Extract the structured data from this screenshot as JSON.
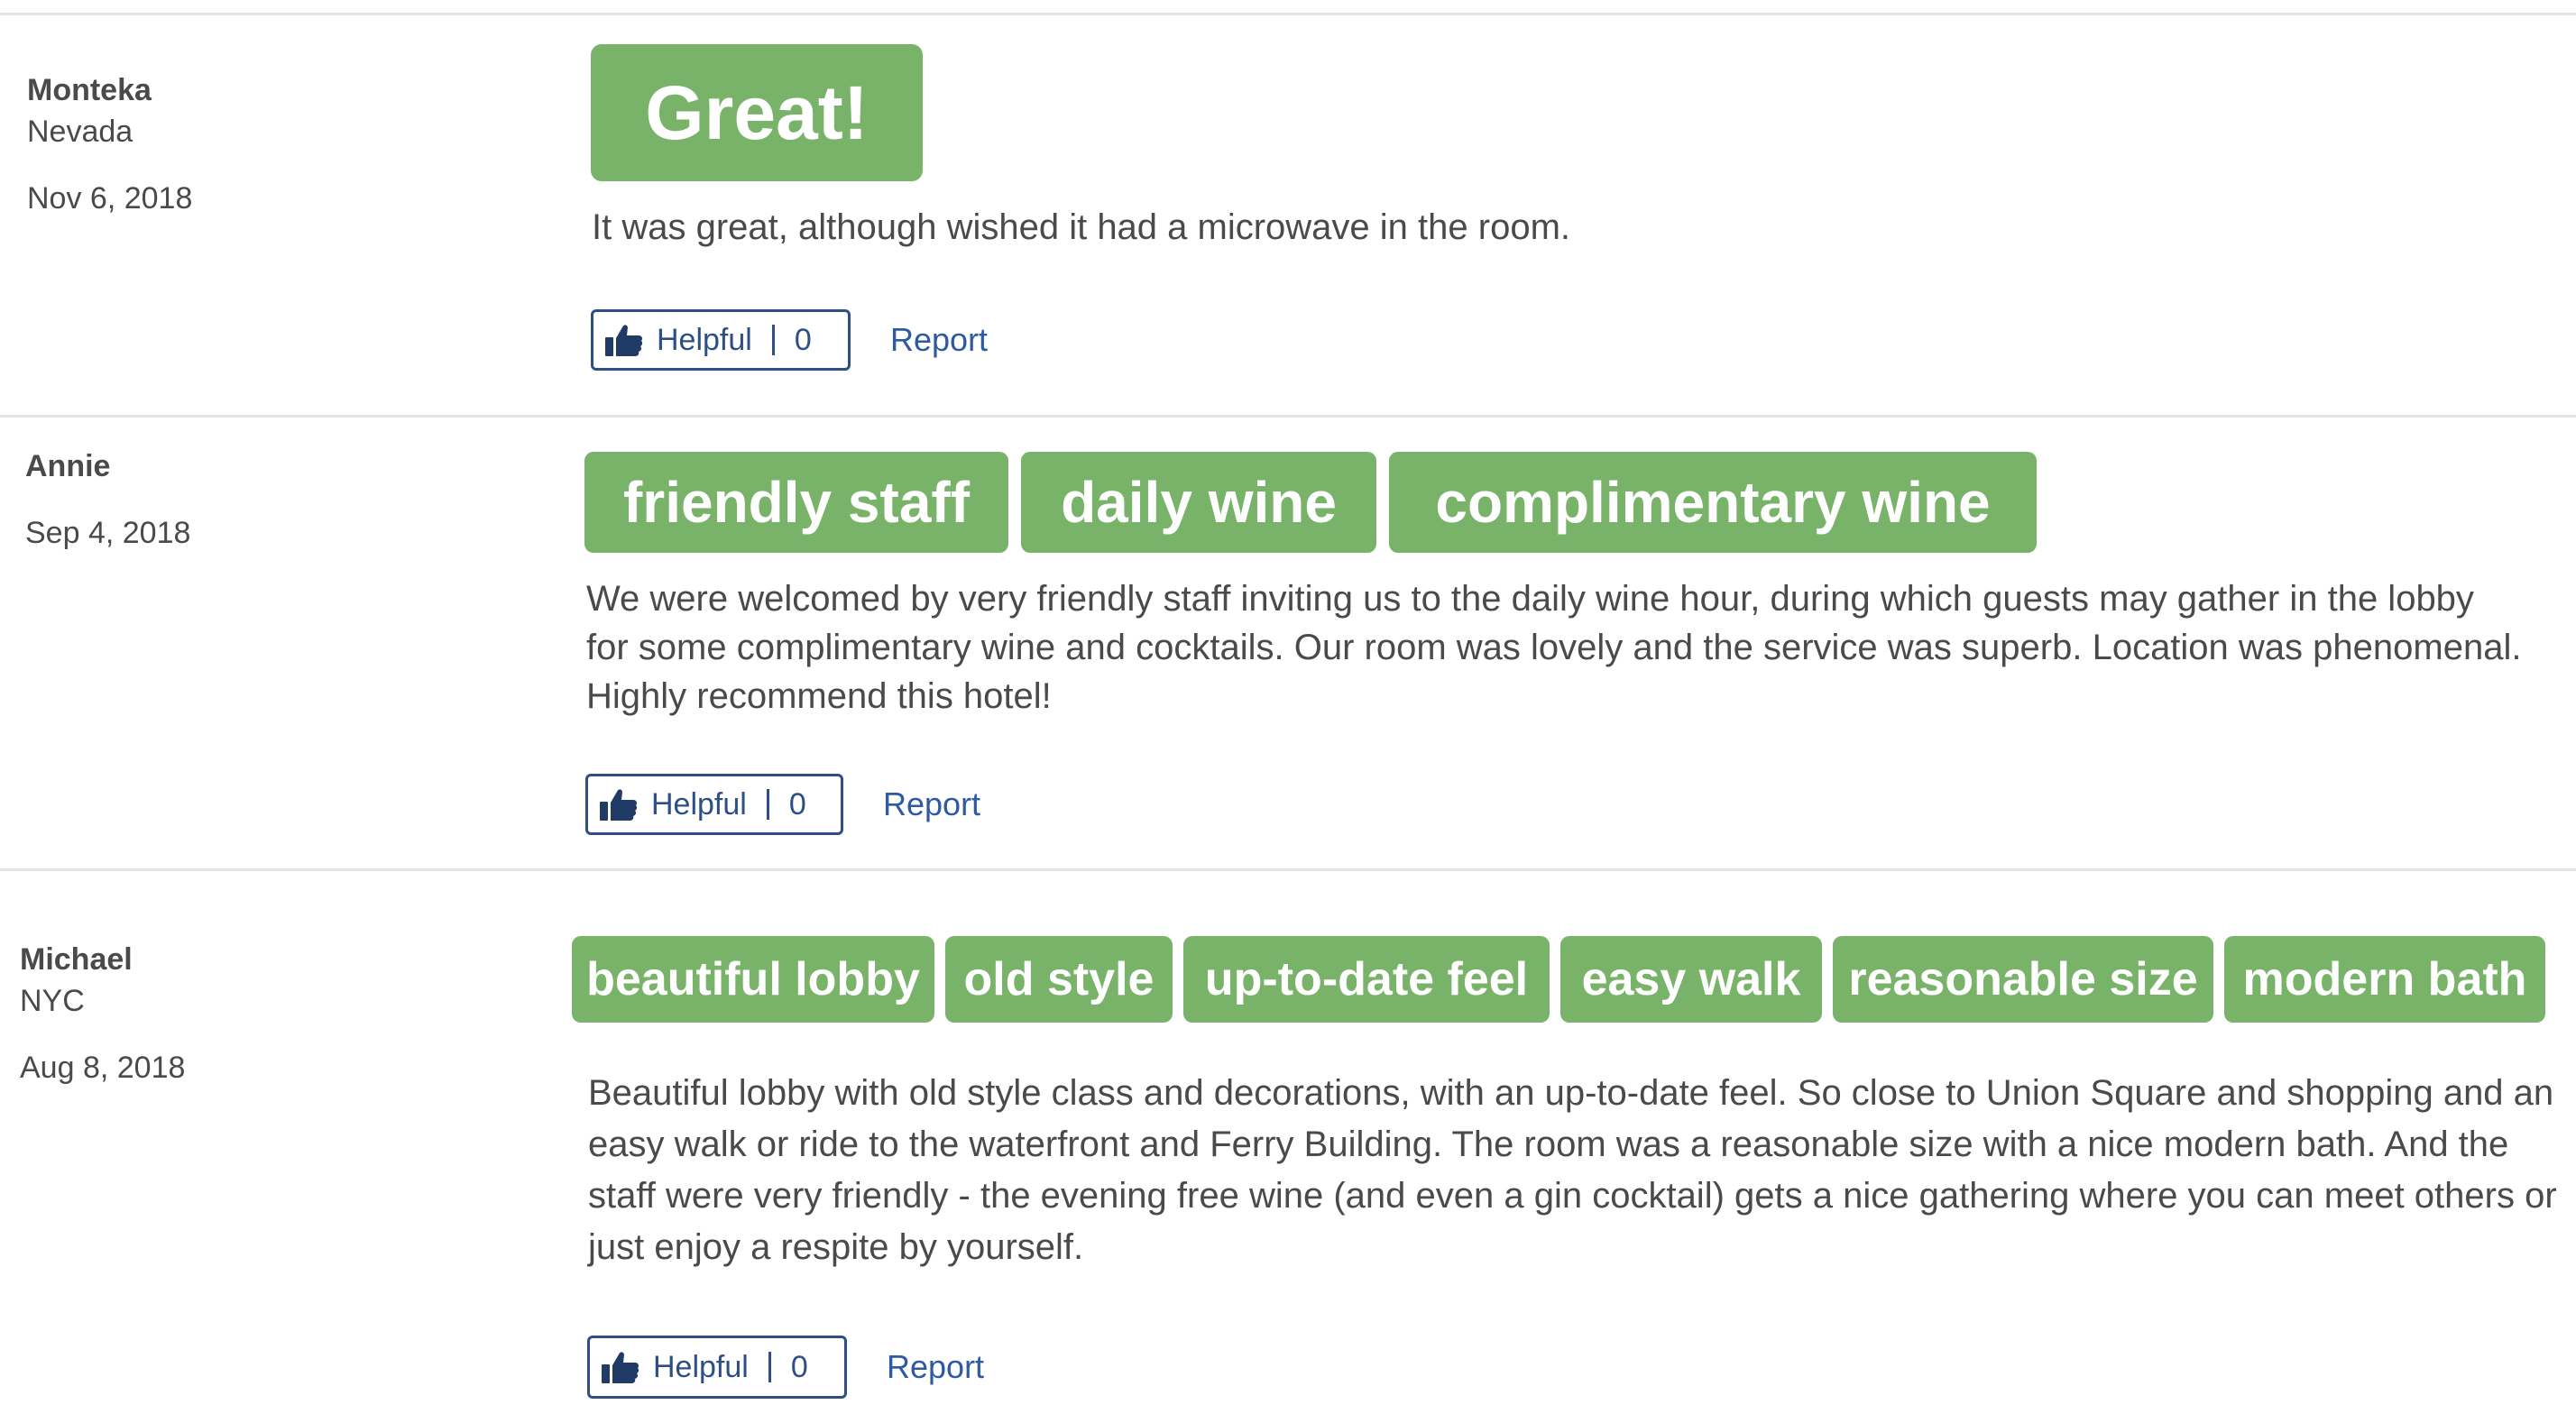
{
  "reviews": [
    {
      "name": "Monteka",
      "location": "Nevada",
      "date": "Nov 6, 2018",
      "tags": [
        "Great!"
      ],
      "text": "It was great, although wished it had a microwave in the room.",
      "helpful_label": "Helpful",
      "helpful_count": "0",
      "report_label": "Report"
    },
    {
      "name": "Annie",
      "location": "",
      "date": "Sep 4, 2018",
      "tags": [
        "friendly staff",
        "daily wine",
        "complimentary wine"
      ],
      "text": "We were welcomed by very friendly staff inviting us to the daily wine hour, during which guests may gather in the lobby for some complimentary wine and cocktails. Our room was lovely and the service was superb. Location was phenomenal. Highly recommend this hotel!",
      "helpful_label": "Helpful",
      "helpful_count": "0",
      "report_label": "Report"
    },
    {
      "name": "Michael",
      "location": "NYC",
      "date": "Aug 8, 2018",
      "tags": [
        "beautiful lobby",
        "old style",
        "up-to-date feel",
        "easy walk",
        "reasonable size",
        "modern bath"
      ],
      "text": "Beautiful lobby with old style class and decorations, with an up-to-date feel. So close to Union Square and shopping and an easy walk or ride to the waterfront and Ferry Building. The room was a reasonable size with a nice modern bath. And the staff were very friendly - the evening free wine (and even a gin cocktail) gets a nice gathering where you can meet others or just enjoy a respite by yourself.",
      "helpful_label": "Helpful",
      "helpful_count": "0",
      "report_label": "Report"
    }
  ],
  "colors": {
    "tag_bg": "#79b36a",
    "link": "#2d5aa0",
    "button_border": "#2d4f86",
    "divider": "#e3e3e3"
  },
  "icons": {
    "helpful": "thumbs-up-icon"
  }
}
